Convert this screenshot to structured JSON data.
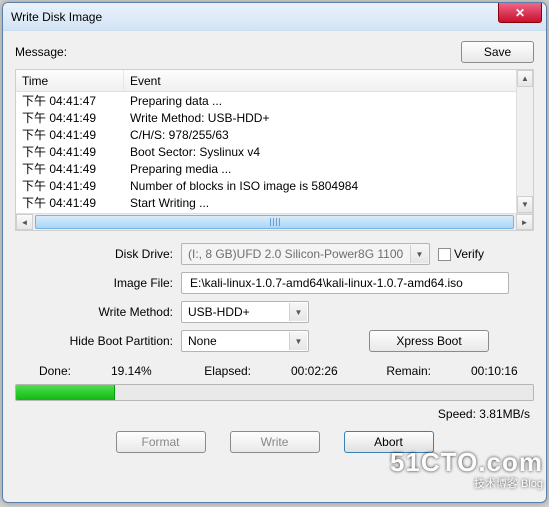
{
  "window": {
    "title": "Write Disk Image",
    "close_glyph": "✕"
  },
  "message_label": "Message:",
  "save_label": "Save",
  "log": {
    "columns": {
      "time": "Time",
      "event": "Event"
    },
    "rows": [
      {
        "time": "下午 04:41:47",
        "event": "Preparing data ..."
      },
      {
        "time": "下午 04:41:49",
        "event": "Write Method: USB-HDD+"
      },
      {
        "time": "下午 04:41:49",
        "event": "C/H/S: 978/255/63"
      },
      {
        "time": "下午 04:41:49",
        "event": "Boot Sector: Syslinux v4"
      },
      {
        "time": "下午 04:41:49",
        "event": "Preparing media ..."
      },
      {
        "time": "下午 04:41:49",
        "event": "Number of blocks in ISO image is 5804984"
      },
      {
        "time": "下午 04:41:49",
        "event": "Start Writing ..."
      }
    ]
  },
  "form": {
    "disk_drive_label": "Disk Drive:",
    "disk_drive_value": "(I:, 8 GB)UFD 2.0 Silicon-Power8G 1100",
    "verify_label": "Verify",
    "image_file_label": "Image File:",
    "image_file_value": "E:\\kali-linux-1.0.7-amd64\\kali-linux-1.0.7-amd64.iso",
    "write_method_label": "Write Method:",
    "write_method_value": "USB-HDD+",
    "hide_boot_label": "Hide Boot Partition:",
    "hide_boot_value": "None",
    "xpress_boot_label": "Xpress Boot"
  },
  "progress": {
    "done_label": "Done:",
    "done_value": "19.14%",
    "elapsed_label": "Elapsed:",
    "elapsed_value": "00:02:26",
    "remain_label": "Remain:",
    "remain_value": "00:10:16",
    "percent": 19.14,
    "speed_label": "Speed:",
    "speed_value": "3.81MB/s"
  },
  "actions": {
    "format": "Format",
    "write": "Write",
    "abort": "Abort"
  },
  "watermark": {
    "brand": "51CTO.com",
    "sub": "技术博客    Blog"
  }
}
